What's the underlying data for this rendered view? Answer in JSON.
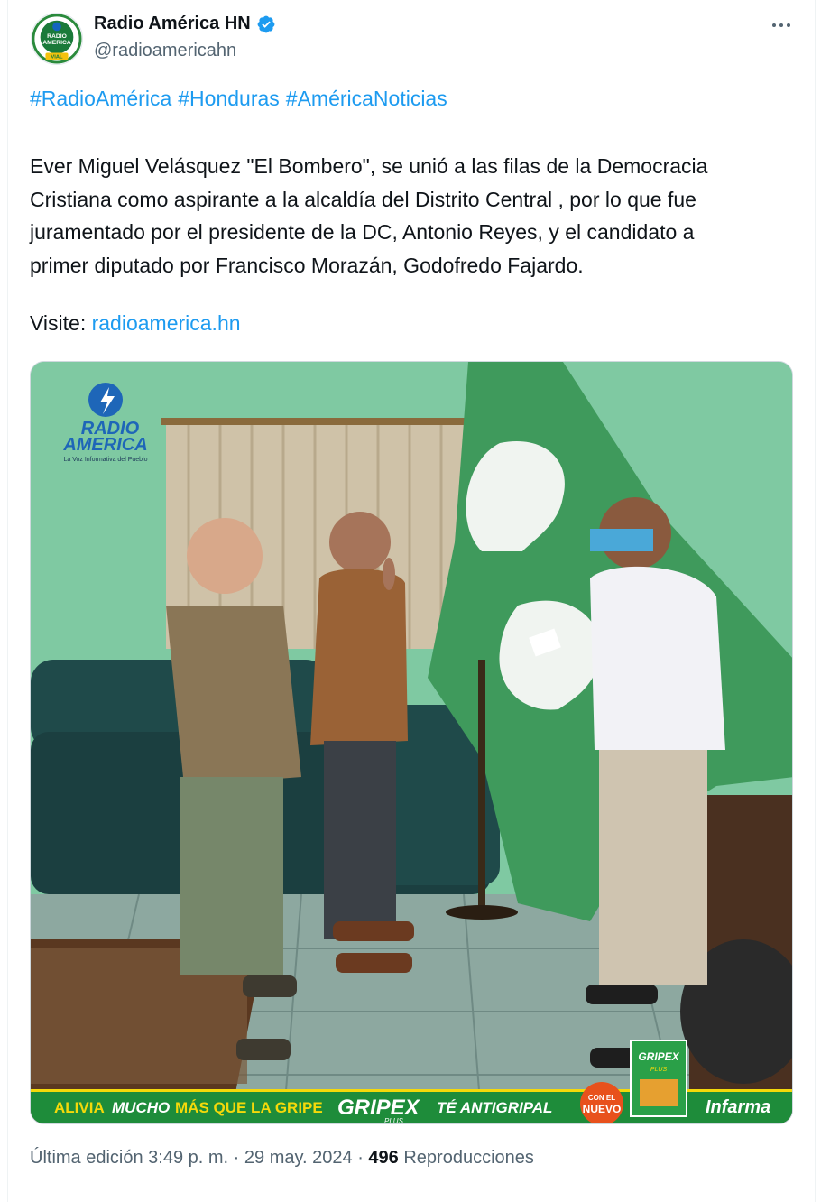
{
  "author": {
    "display_name": "Radio América HN",
    "handle": "@radioamericahn",
    "verified": true,
    "avatar_icon": "radio-america-logo",
    "avatar_lines": [
      "RADIO",
      "AMERICA",
      "VIAL"
    ]
  },
  "tweet": {
    "hashtags": [
      "#RadioAmérica",
      "#Honduras",
      "#AméricaNoticias"
    ],
    "text_lines": [
      "Ever Miguel Velásquez \"El Bombero\", se unió a las filas de la Democracia",
      "Cristiana como aspirante a la alcaldía del Distrito Central , por lo que fue",
      "juramentado por el presidente de la DC, Antonio Reyes, y el candidato a",
      "primer diputado por Francisco Morazán, Godofredo Fajardo."
    ],
    "visit_label": "Visite:",
    "visit_link": "radioamerica.hn"
  },
  "media": {
    "logo_line1": "RADIO",
    "logo_line2": "AMERICA",
    "logo_tagline": "La Voz Informativa del Pueblo",
    "ad": {
      "text1": "ALIVIA",
      "text2": "MUCHO",
      "text3": "MÁS QUE LA GRIPE",
      "brand": "GRIPEX",
      "brand_sub": "PLUS",
      "text4": "TÉ ANTIGRIPAL",
      "badge_line1": "CON EL",
      "badge_line2": "NUEVO",
      "package_brand": "GRIPEX",
      "package_sub": "PLUS",
      "sponsor": "Infarma"
    }
  },
  "meta": {
    "edited_label": "Última edición 3:49 p. m.",
    "separator": "·",
    "date": "29 may. 2024",
    "views_count": "496",
    "views_label": "Reproducciones"
  },
  "colors": {
    "link": "#1d9bf0",
    "text": "#0f1419",
    "secondary": "#536471",
    "verified": "#1d9bf0",
    "wall": "#7fc9a2",
    "flag": "#3f9a5c",
    "ad_bar": "#1e8c3a"
  }
}
